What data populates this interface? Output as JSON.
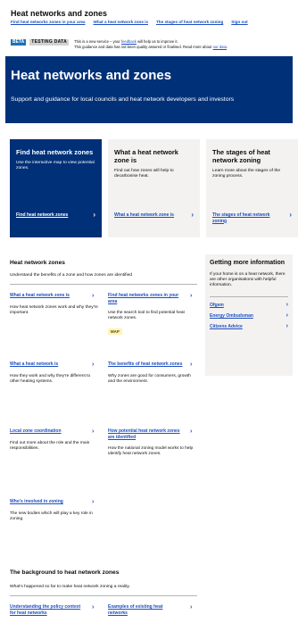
{
  "header": {
    "title": "Heat networks and zones",
    "nav": [
      "Find heat networks zones in your area",
      "What a heat network zone is",
      "The stages of heat network zoning",
      "Sign out"
    ]
  },
  "banner": {
    "beta": "BETA",
    "testing": "TESTING DATA",
    "line1_pre": "This is a new service – your ",
    "line1_link": "feedback",
    "line1_post": " will help us to improve it.",
    "line2_pre": "This guidance and data has not been quality assured or finalised. Read more about ",
    "line2_link": "our data",
    "line2_post": "."
  },
  "hero": {
    "title": "Heat networks and zones",
    "subtitle": "Support and guidance for local councils and heat network developers and investors"
  },
  "cards": [
    {
      "title": "Find heat network zones",
      "desc": "Use the interactive map to view potential zones.",
      "link": "Find heat network zones"
    },
    {
      "title": "What a heat network zone is",
      "desc": "Find out how zones will help to decarbonise heat.",
      "link": "What a heat network zone is"
    },
    {
      "title": "The stages of heat network zoning",
      "desc": "Learn more about the stages of the zoning process.",
      "link": "The stages of heat network zoning"
    }
  ],
  "hnz": {
    "title": "Heat network zones",
    "subtitle": "Understand the benefits of a zone and how zones are identified",
    "items": [
      {
        "title": "What a heat network zone is",
        "desc": "How heat network zones work and why they're important."
      },
      {
        "title": "Find heat networks zones in your area",
        "desc": "Use the search tool to find potential heat network zones.",
        "tag": "MAP"
      },
      {
        "title": "What a heat network is",
        "desc": "How they work and why they're different to other heating systems."
      },
      {
        "title": "The benefits of heat network zones",
        "desc": "Why zones are good for consumers, growth and the environment."
      },
      {
        "title": "Local zone coordination",
        "desc": "Find out more about the role and the main responsibilities."
      },
      {
        "title": "How potential heat network zones are identified",
        "desc": "How the national zoning model works to help identify heat network zones."
      },
      {
        "title": "Who's involved in zoning",
        "desc": "The new bodies which will play a key role in zoning."
      }
    ]
  },
  "aside": {
    "title": "Getting more information",
    "desc": "If your home is on a heat network, there are other organisations with helpful information.",
    "links": [
      "Ofgem",
      "Energy Ombudsman",
      "Citizens Advice"
    ]
  },
  "background": {
    "title": "The background to heat network zones",
    "subtitle": "What's happened so far to make heat network zoning a reality.",
    "items": [
      {
        "title": "Understanding the policy context for heat networks"
      },
      {
        "title": "Examples of existing heat networks"
      }
    ]
  },
  "chevron": "›"
}
